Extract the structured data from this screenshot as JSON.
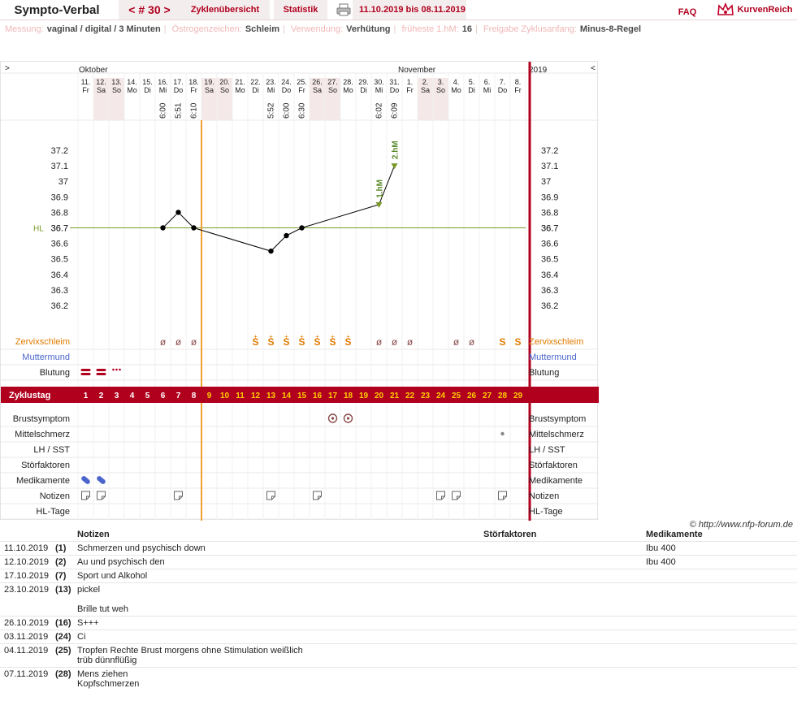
{
  "app": {
    "title": "Sympto-Verbal",
    "cycle_nav": "< # 30 >",
    "tab_overview": "Zyklenübersicht",
    "tab_stats": "Statistik",
    "date_range": "11.10.2019 bis 08.11.2019",
    "faq": "FAQ",
    "logo": "KurvenReich"
  },
  "info": [
    {
      "label": "Messung:",
      "value": "vaginal / digital / 3 Minuten"
    },
    {
      "label": "Östrogenzeichen:",
      "value": "Schleim"
    },
    {
      "label": "Verwendung:",
      "value": "Verhütung"
    },
    {
      "label": "früheste 1.hM:",
      "value": "16"
    },
    {
      "label": "Freigabe Zyklusanfang:",
      "value": "Minus-8-Regel"
    }
  ],
  "chart": {
    "nav_left": ">",
    "nav_right": "<",
    "month1": "Oktober",
    "month2": "November",
    "year": "2019",
    "days": [
      {
        "d": "11.",
        "w": "Fr"
      },
      {
        "d": "12.",
        "w": "Sa"
      },
      {
        "d": "13.",
        "w": "So"
      },
      {
        "d": "14.",
        "w": "Mo"
      },
      {
        "d": "15.",
        "w": "Di"
      },
      {
        "d": "16.",
        "w": "Mi"
      },
      {
        "d": "17.",
        "w": "Do"
      },
      {
        "d": "18.",
        "w": "Fr"
      },
      {
        "d": "19.",
        "w": "Sa"
      },
      {
        "d": "20.",
        "w": "So"
      },
      {
        "d": "21.",
        "w": "Mo"
      },
      {
        "d": "22.",
        "w": "Di"
      },
      {
        "d": "23.",
        "w": "Mi"
      },
      {
        "d": "24.",
        "w": "Do"
      },
      {
        "d": "25.",
        "w": "Fr"
      },
      {
        "d": "26.",
        "w": "Sa"
      },
      {
        "d": "27.",
        "w": "So"
      },
      {
        "d": "28.",
        "w": "Mo"
      },
      {
        "d": "29.",
        "w": "Di"
      },
      {
        "d": "30.",
        "w": "Mi"
      },
      {
        "d": "31.",
        "w": "Do"
      },
      {
        "d": "1.",
        "w": "Fr"
      },
      {
        "d": "2.",
        "w": "Sa"
      },
      {
        "d": "3.",
        "w": "So"
      },
      {
        "d": "4.",
        "w": "Mo"
      },
      {
        "d": "5.",
        "w": "Di"
      },
      {
        "d": "6.",
        "w": "Mi"
      },
      {
        "d": "7.",
        "w": "Do"
      },
      {
        "d": "8.",
        "w": "Fr"
      }
    ],
    "weekend_days": [
      2,
      3,
      9,
      10,
      16,
      17,
      23,
      24
    ],
    "times": {
      "6": "6:00",
      "7": "5:51",
      "8": "6:10",
      "13": "5:52",
      "14": "6:00",
      "15": "6:30",
      "20": "6:02",
      "21": "6:09"
    },
    "y_ticks": [
      "37.2",
      "37.1",
      "37",
      "36.9",
      "36.8",
      "36.7",
      "36.6",
      "36.5",
      "36.4",
      "36.3",
      "36.2"
    ],
    "hl_label": "HL",
    "hl_value": 36.7,
    "temps": [
      {
        "day": 6,
        "t": 36.7
      },
      {
        "day": 7,
        "t": 36.8
      },
      {
        "day": 8,
        "t": 36.7
      },
      {
        "day": 13,
        "t": 36.55
      },
      {
        "day": 14,
        "t": 36.65
      },
      {
        "day": 15,
        "t": 36.7
      },
      {
        "day": 20,
        "t": 36.85,
        "hm": "1.hM"
      },
      {
        "day": 21,
        "t": 37.1,
        "hm": "2.hM"
      }
    ],
    "cycle_label": "Zyklustag",
    "rows_top": [
      "Zervixschleim",
      "Muttermund",
      "Blutung"
    ],
    "rows_bottom": [
      "Brustsymptom",
      "Mittelschmerz",
      "LH / SST",
      "Störfaktoren",
      "Medikamente",
      "Notizen",
      "HL-Tage"
    ],
    "cervix": {
      "6": "ø",
      "7": "ø",
      "8": "ø",
      "12": "S+",
      "13": "S+",
      "14": "S+",
      "15": "S+",
      "16": "S+",
      "17": "S+",
      "18": "S+",
      "20": "ø",
      "21": "ø",
      "22": "ø",
      "25": "ø",
      "26": "ø",
      "28": "S",
      "29": "S"
    },
    "bleeding": {
      "1": "heavy",
      "2": "heavy",
      "3": "spotting"
    },
    "breast": [
      17,
      18
    ],
    "midpain": [
      28
    ],
    "meds": [
      1,
      2
    ],
    "notes": [
      1,
      2,
      7,
      13,
      16,
      24,
      25,
      28
    ],
    "colors": {
      "accent": "#b0001e",
      "cervix": "#e07b00",
      "muttermund": "#4a66cc",
      "peak_line": "#f0a030",
      "hl_line": "#7a9a2a",
      "hm_label": "#5a8a2a",
      "weekend": "#f5e8e8"
    }
  },
  "credit": "© http://www.nfp-forum.de",
  "notes_table": {
    "headers": {
      "notes": "Notizen",
      "disturbances": "Störfaktoren",
      "medication": "Medikamente"
    },
    "rows": [
      {
        "date": "11.10.2019",
        "day": "(1)",
        "note": "Schmerzen und psychisch down",
        "med": "Ibu 400"
      },
      {
        "date": "12.10.2019",
        "day": "(2)",
        "note": "Au und psychisch den",
        "med": "Ibu 400"
      },
      {
        "date": "17.10.2019",
        "day": "(7)",
        "note": "Sport und Alkohol",
        "med": ""
      },
      {
        "date": "23.10.2019",
        "day": "(13)",
        "note": "pickel\n\nBrille tut weh",
        "med": ""
      },
      {
        "date": "26.10.2019",
        "day": "(16)",
        "note": "S+++",
        "med": ""
      },
      {
        "date": "03.11.2019",
        "day": "(24)",
        "note": "Ci",
        "med": ""
      },
      {
        "date": "04.11.2019",
        "day": "(25)",
        "note": "Tropfen Rechte Brust morgens ohne Stimulation weißlich\ntrüb dünnflüßig",
        "med": ""
      },
      {
        "date": "07.11.2019",
        "day": "(28)",
        "note": "Mens ziehen\nKopfschmerzen",
        "med": ""
      }
    ]
  }
}
